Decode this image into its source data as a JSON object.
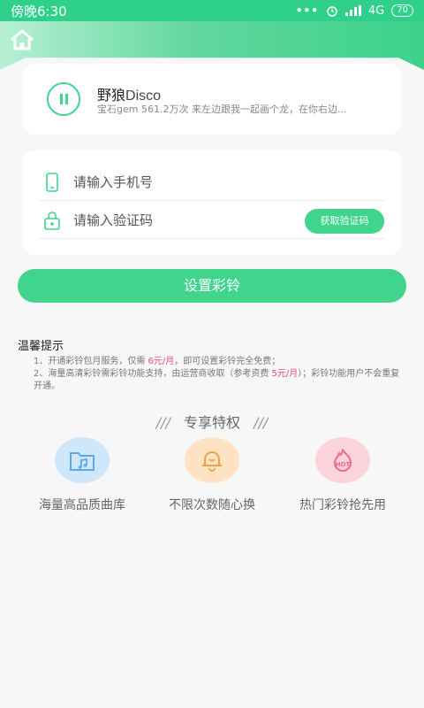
{
  "status_bar": {
    "time": "傍晚6:30",
    "dots": "•••",
    "network": "4G",
    "battery": "70"
  },
  "player": {
    "title_cn": "野狼",
    "title_en": "Disco",
    "subtitle": "宝石gem 561.2万次 来左边跟我一起画个龙，在你右边..."
  },
  "form": {
    "phone_placeholder": "请输入手机号",
    "code_placeholder": "请输入验证码",
    "get_code_label": "获取验证码"
  },
  "submit_label": "设置彩铃",
  "tips": {
    "title": "温馨提示",
    "line1_pre": "1、开通彩铃包月服务，仅需 ",
    "line1_price": "6元/月",
    "line1_post": "，即可设置彩铃完全免费；",
    "line2_pre": "2、海量高清彩铃需彩铃功能支持，由运营商收取（参考资费 ",
    "line2_price": "5元/月",
    "line2_post": "）；彩铃功能用户不会重复开通。"
  },
  "privileges": {
    "slash_left": "///",
    "title": "专享特权",
    "slash_right": "///",
    "items": [
      {
        "label": "海量高品质曲库",
        "icon": "music-folder-icon",
        "color": "#5aa9ec"
      },
      {
        "label": "不限次数随心换",
        "icon": "bell-icon",
        "color": "#f3a24a"
      },
      {
        "label": "热门彩铃抢先用",
        "icon": "hot-icon",
        "color": "#ee6b8e"
      }
    ]
  },
  "colors": {
    "accent": "#3fd58c",
    "highlight": "#e94c7e"
  }
}
